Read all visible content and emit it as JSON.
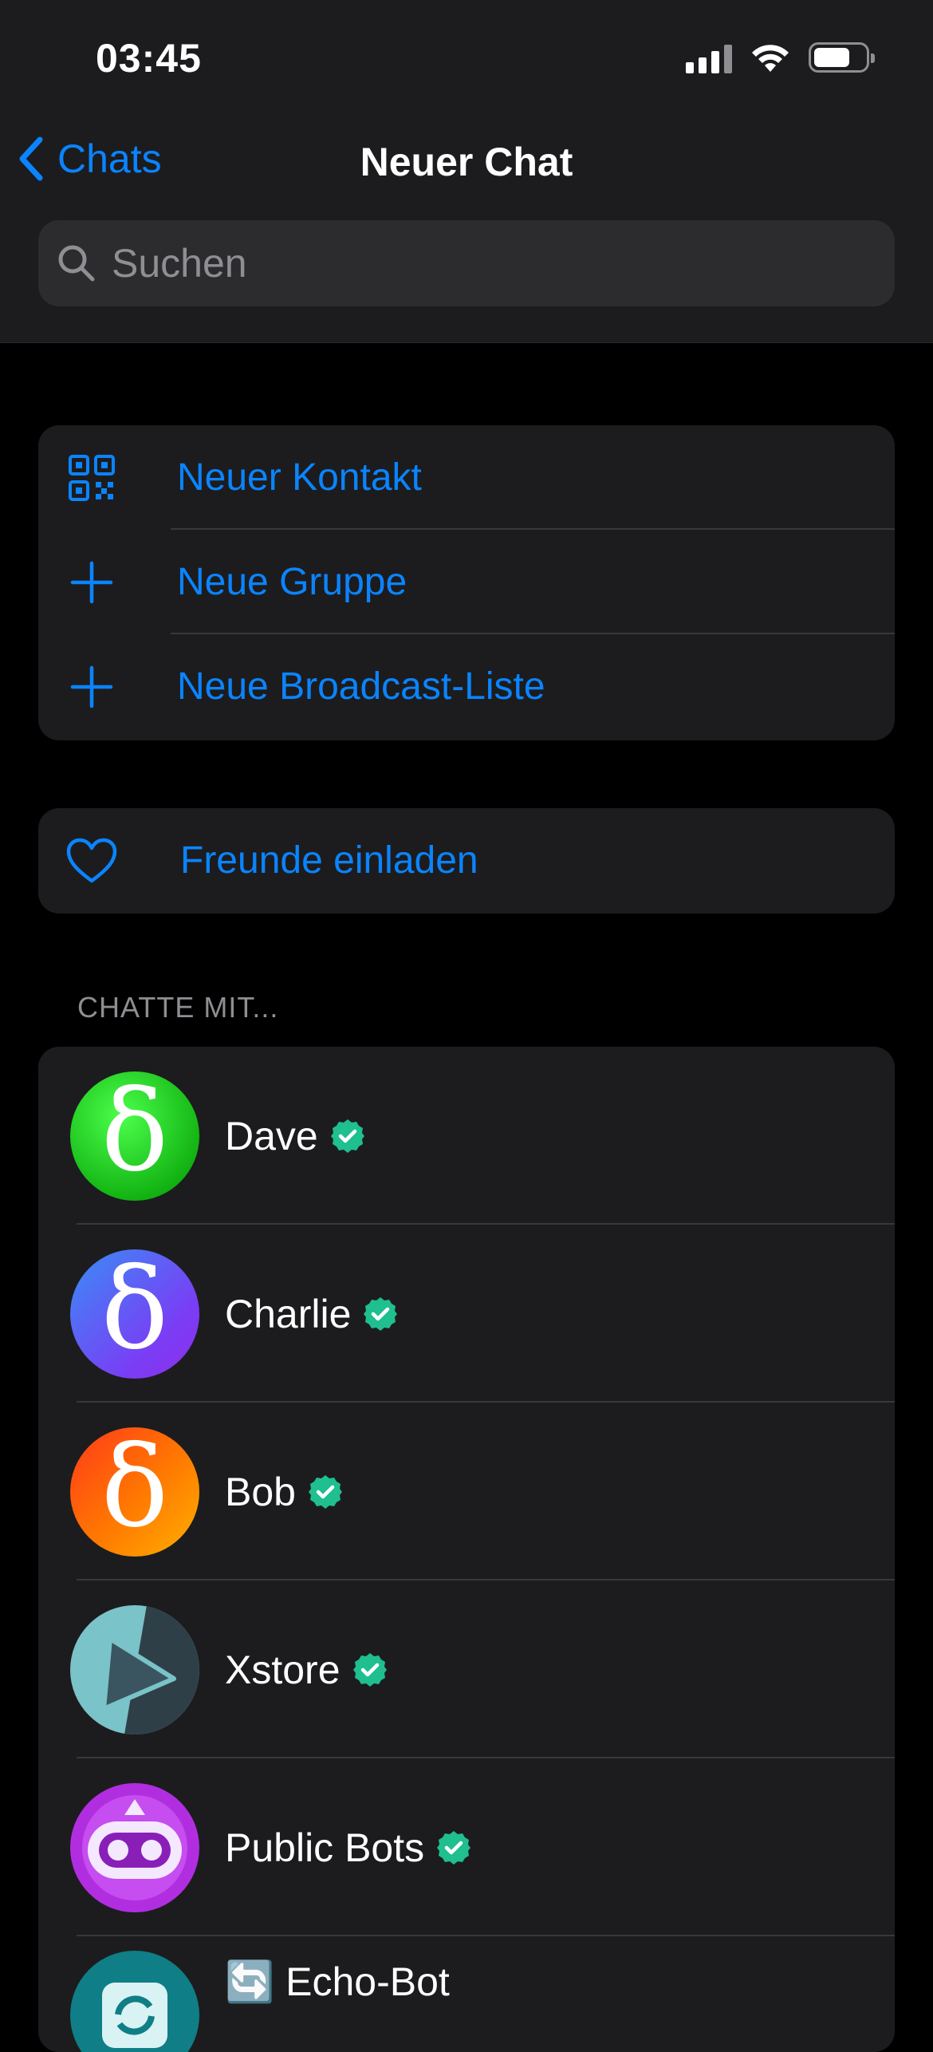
{
  "status_bar": {
    "time": "03:45"
  },
  "nav": {
    "back_label": "Chats",
    "title": "Neuer Chat"
  },
  "search": {
    "placeholder": "Suchen"
  },
  "actions": [
    {
      "label": "Neuer Kontakt",
      "icon": "qr-code-icon"
    },
    {
      "label": "Neue Gruppe",
      "icon": "plus-icon"
    },
    {
      "label": "Neue Broadcast-Liste",
      "icon": "plus-icon"
    }
  ],
  "invite": {
    "label": "Freunde einladen",
    "icon": "heart-icon"
  },
  "section_header": "CHATTE MIT...",
  "contacts": [
    {
      "name": "Dave",
      "verified": true,
      "avatar": "delta-green"
    },
    {
      "name": "Charlie",
      "verified": true,
      "avatar": "delta-purple"
    },
    {
      "name": "Bob",
      "verified": true,
      "avatar": "delta-orange"
    },
    {
      "name": "Xstore",
      "verified": true,
      "avatar": "play-teal"
    },
    {
      "name": "Public Bots",
      "verified": true,
      "avatar": "robot-purple"
    },
    {
      "name": "🔄 Echo-Bot",
      "verified": false,
      "avatar": "refresh-teal"
    }
  ],
  "colors": {
    "accent": "#0a84ff",
    "verified": "#1fbf8f",
    "background": "#000000",
    "surface": "#1c1c1e"
  }
}
